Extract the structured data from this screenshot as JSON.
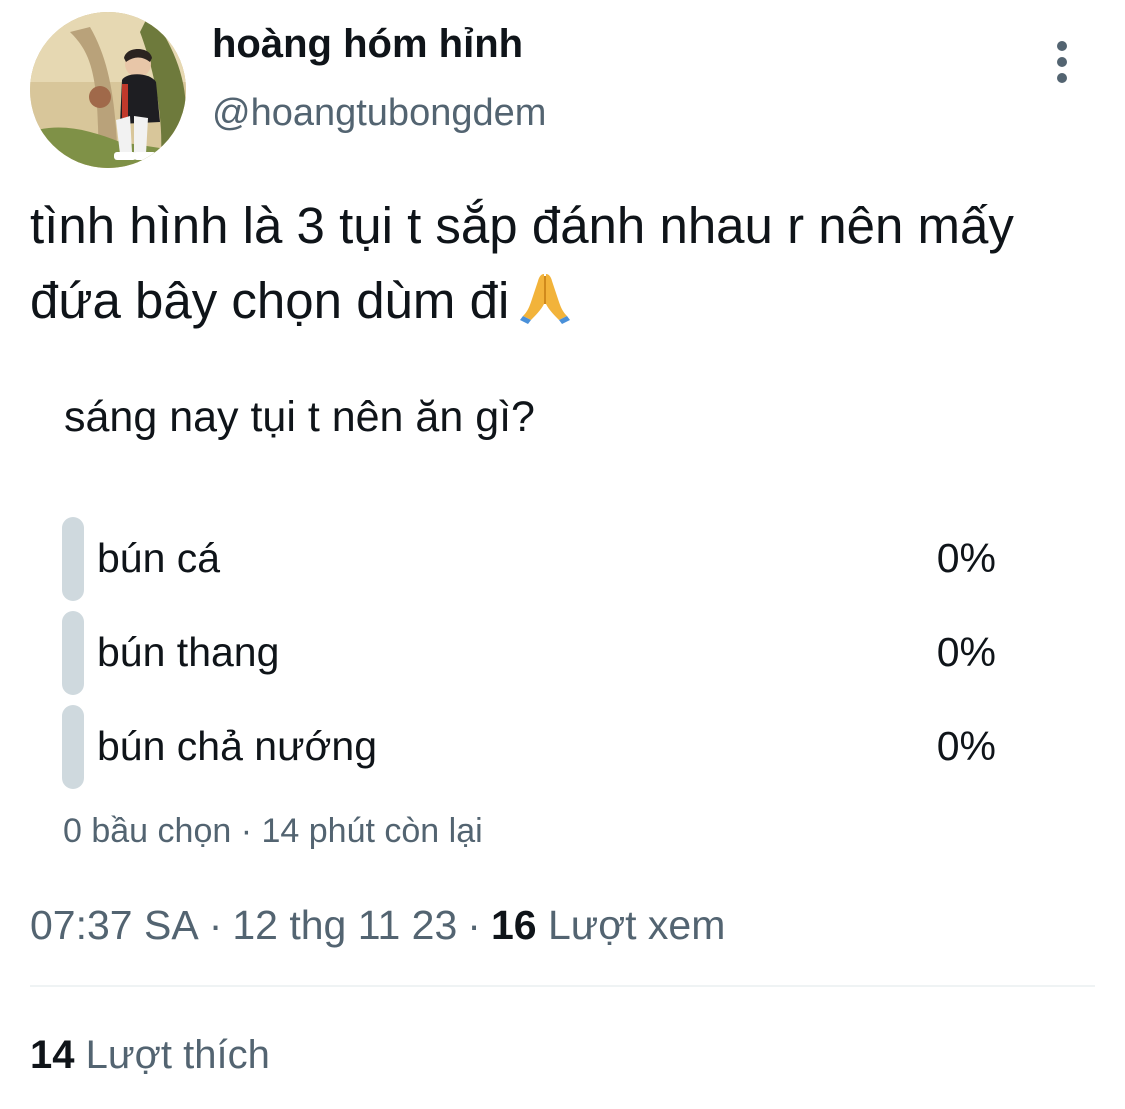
{
  "author": {
    "display_name": "hoàng hóm hỉnh",
    "handle": "@hoangtubongdem"
  },
  "tweet": {
    "text": "tình hình là 3 tụi t sắp đánh nhau r nên mấy đứa bây chọn dùm đi",
    "emoji": "folded-hands"
  },
  "poll": {
    "question": "sáng nay tụi t nên ăn gì?",
    "options": [
      {
        "label": "bún cá",
        "percent": "0%",
        "fraction": 0
      },
      {
        "label": "bún thang",
        "percent": "0%",
        "fraction": 0
      },
      {
        "label": "bún chả nướng",
        "percent": "0%",
        "fraction": 0
      }
    ],
    "votes": "0 bầu chọn",
    "time_left": "14 phút còn lại",
    "separator": "·"
  },
  "meta": {
    "time": "07:37 SA",
    "date": "12 thg 11 23",
    "separator": "·",
    "views_count": "16",
    "views_label": "Lượt xem"
  },
  "likes": {
    "count": "14",
    "label": "Lượt thích"
  },
  "icons": {
    "more": "more-vertical-icon"
  },
  "colors": {
    "text_primary": "#0f1419",
    "text_secondary": "#536471",
    "poll_bar": "#cfd9de",
    "divider": "#eff3f4"
  }
}
